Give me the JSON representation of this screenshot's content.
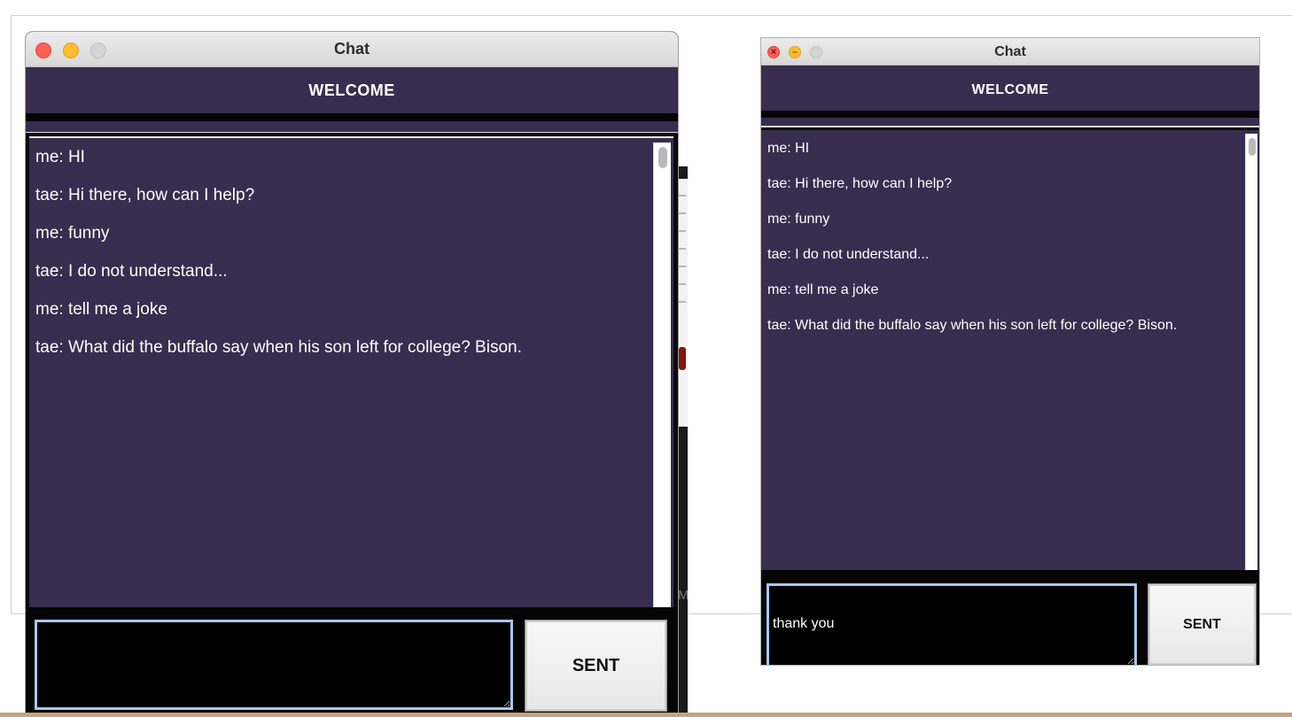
{
  "left_window": {
    "title": "Chat",
    "header": "WELCOME",
    "messages": [
      "me: HI",
      "tae: Hi there, how can I help?",
      "me: funny",
      "tae: I do not understand...",
      "me: tell me a joke",
      "tae: What did the buffalo say when his son left for college? Bison."
    ],
    "input_value": "",
    "send_label": "SENT"
  },
  "right_window": {
    "title": "Chat",
    "header": "WELCOME",
    "messages": [
      "me: HI",
      "tae: Hi there, how can I help?",
      "me: funny",
      "tae: I do not understand...",
      "me: tell me a joke",
      "tae: What did the buffalo say when his son left for college? Bison."
    ],
    "input_value": "thank you",
    "send_label": "SENT"
  },
  "colors": {
    "chat_background": "#382d4e",
    "input_background": "#000000",
    "input_border": "#a9c6ee",
    "text": "#ffffff"
  }
}
